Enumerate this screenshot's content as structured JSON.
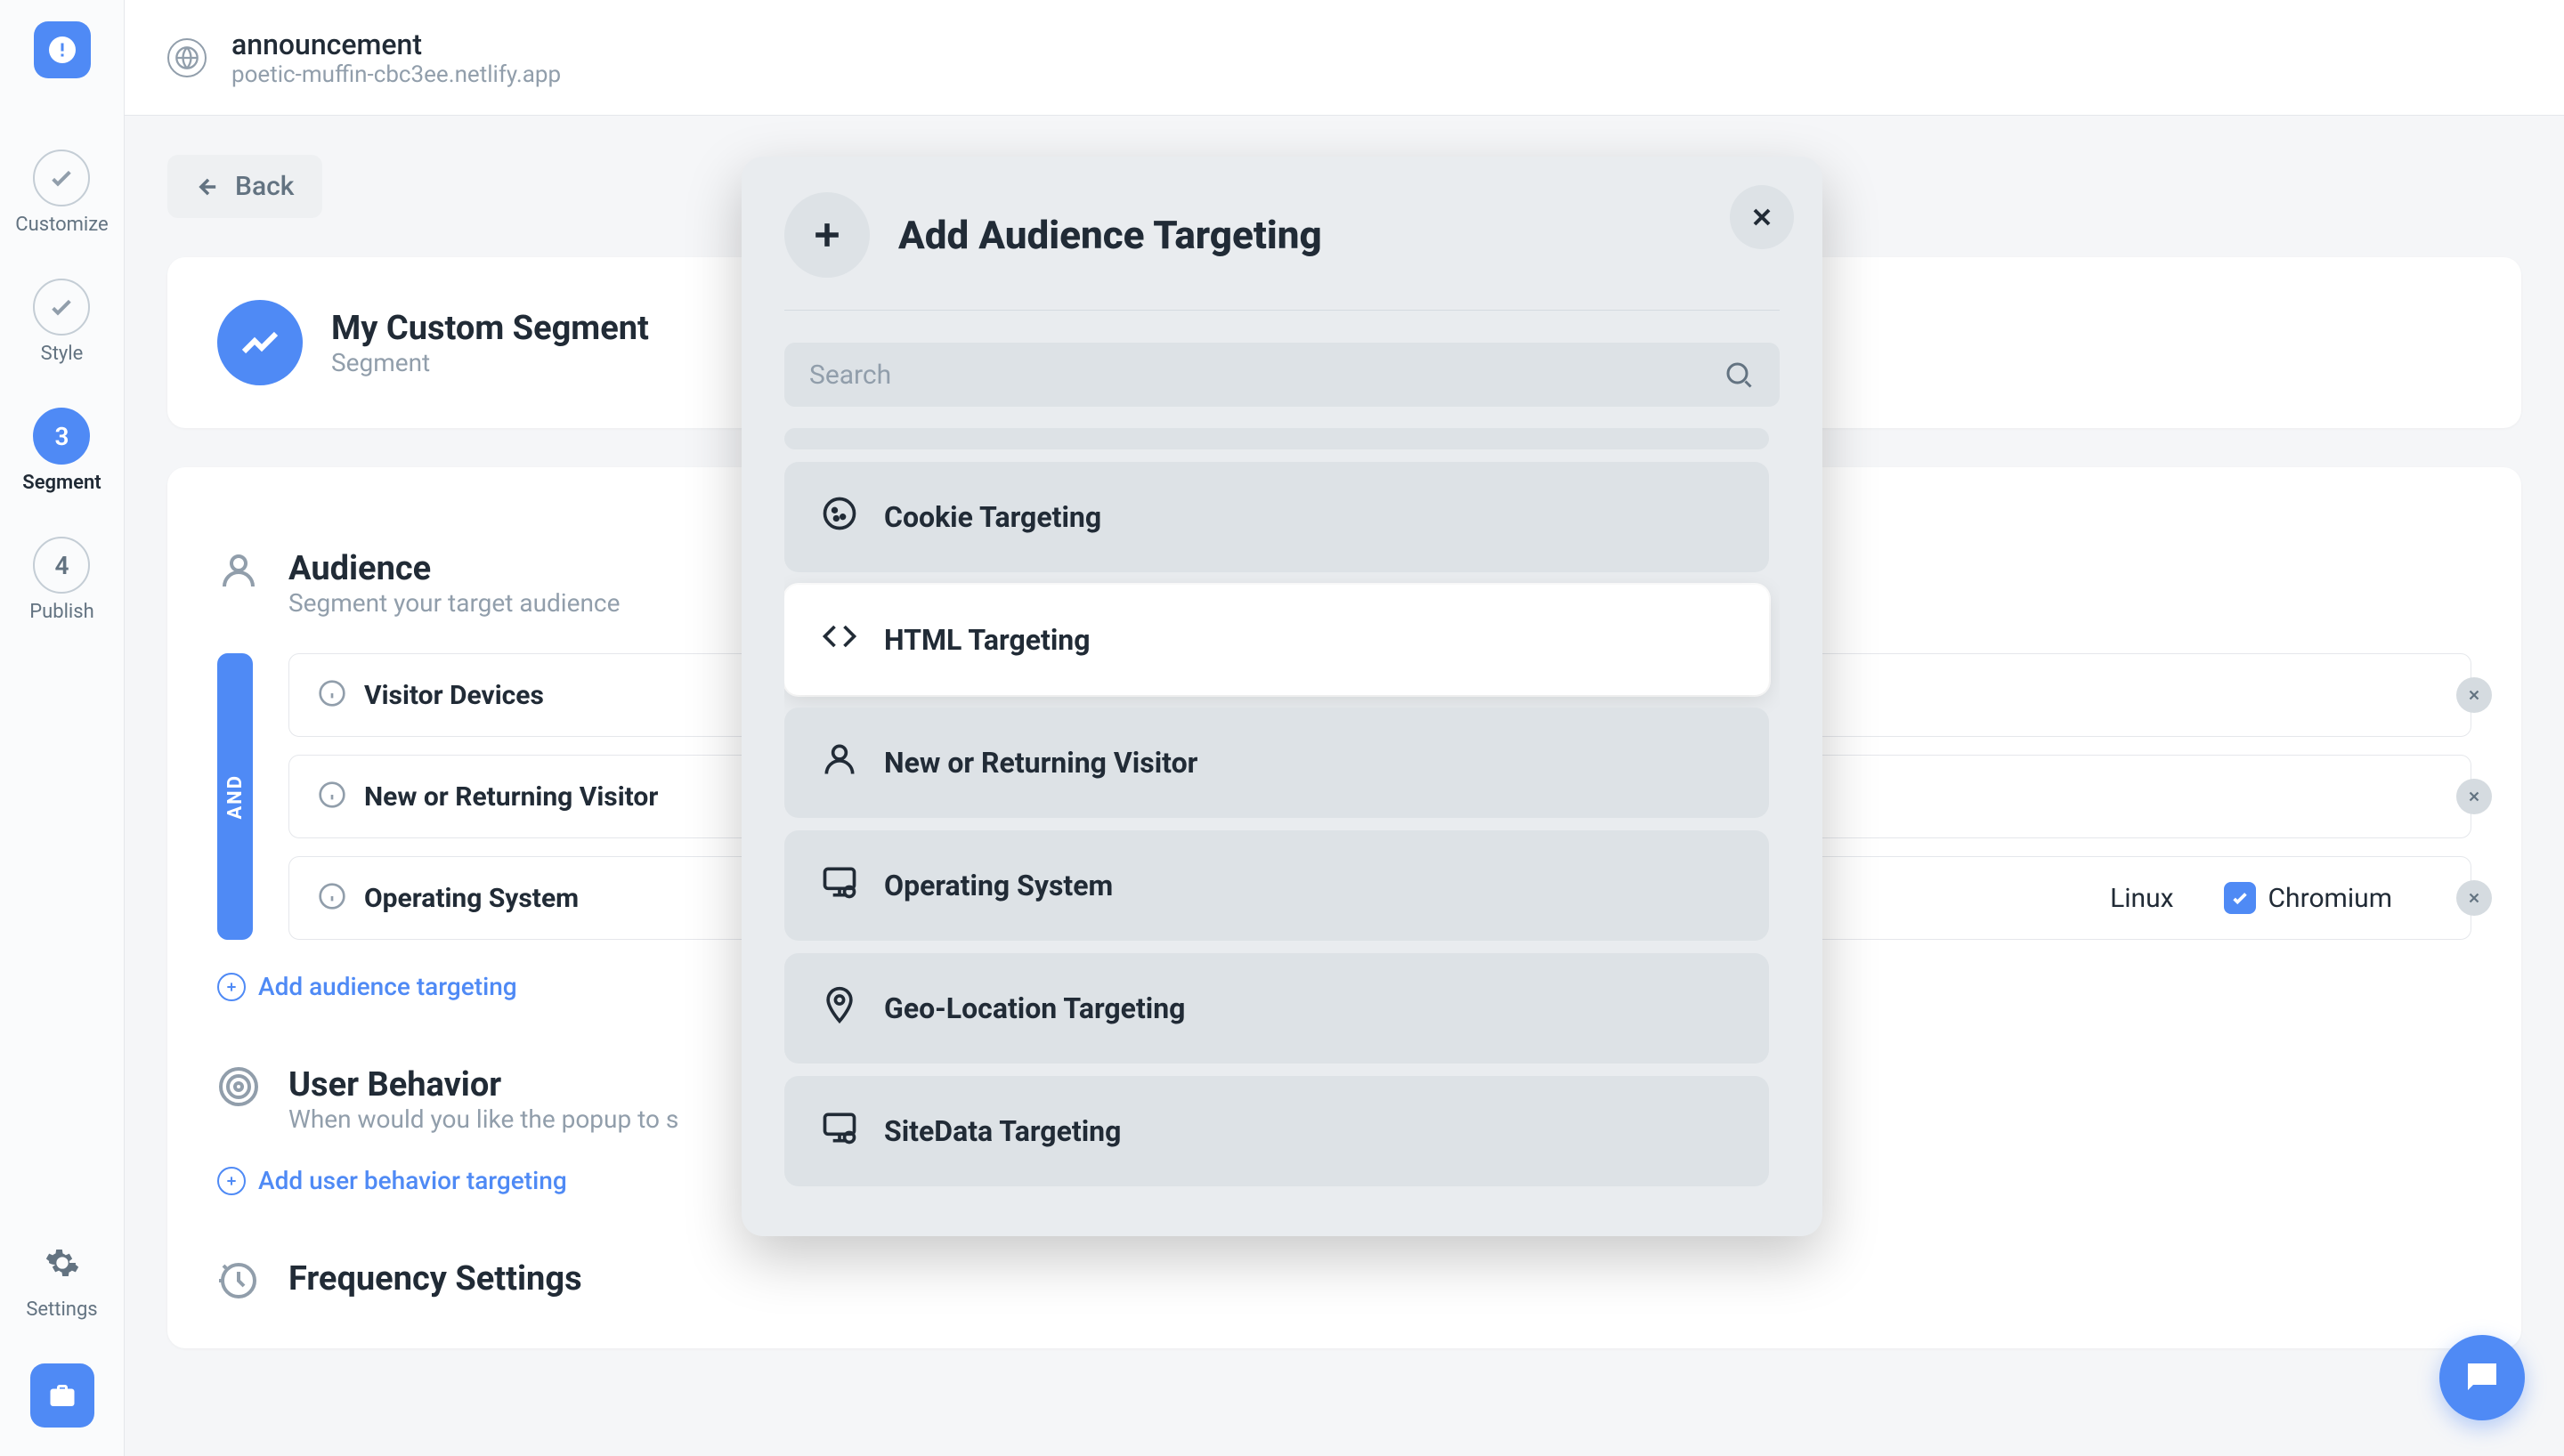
{
  "topbar": {
    "title": "announcement",
    "subtitle": "poetic-muffin-cbc3ee.netlify.app"
  },
  "sidebar": {
    "items": [
      {
        "label": "Customize",
        "kind": "check"
      },
      {
        "label": "Style",
        "kind": "check"
      },
      {
        "label": "Segment",
        "kind": "number",
        "number": "3",
        "active": true
      },
      {
        "label": "Publish",
        "kind": "number",
        "number": "4"
      }
    ],
    "settings_label": "Settings"
  },
  "main": {
    "back_label": "Back",
    "segment": {
      "title": "My Custom Segment",
      "subtitle": "Segment"
    },
    "audience": {
      "title": "Audience",
      "desc": "Segment your target audience",
      "and_label": "AND",
      "rules": [
        {
          "label": "Visitor Devices",
          "values": []
        },
        {
          "label": "New or Returning Visitor",
          "values": []
        },
        {
          "label": "Operating System",
          "values": [
            {
              "checked": false,
              "text": "Linux"
            },
            {
              "checked": true,
              "text": "Chromium"
            }
          ]
        }
      ],
      "add_label": "Add audience targeting"
    },
    "behavior": {
      "title": "User Behavior",
      "desc_prefix": "When would you like the popup to s",
      "add_label": "Add user behavior targeting"
    },
    "frequency": {
      "title": "Frequency Settings"
    }
  },
  "modal": {
    "title": "Add Audience Targeting",
    "search_placeholder": "Search",
    "options": [
      {
        "label": "Cookie Targeting",
        "icon": "cookie"
      },
      {
        "label": "HTML Targeting",
        "icon": "code",
        "highlight": true
      },
      {
        "label": "New or Returning Visitor",
        "icon": "user"
      },
      {
        "label": "Operating System",
        "icon": "monitor-gear"
      },
      {
        "label": "Geo-Location Targeting",
        "icon": "pin"
      },
      {
        "label": "SiteData Targeting",
        "icon": "monitor-gear"
      }
    ]
  }
}
